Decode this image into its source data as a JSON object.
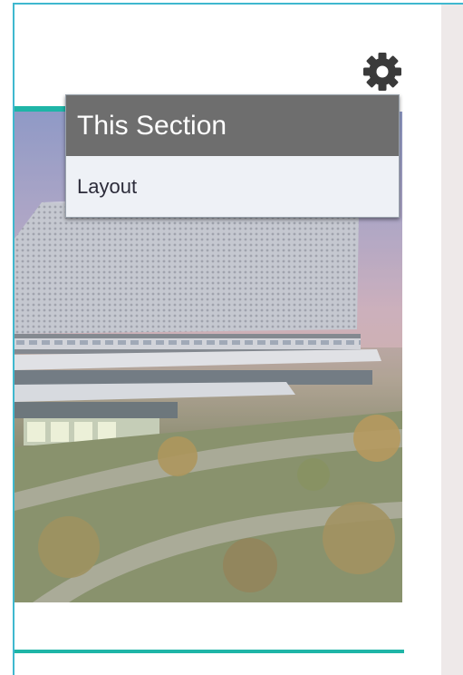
{
  "settings": {
    "icon": "gear-icon",
    "menu": {
      "header": "This Section",
      "items": [
        {
          "label": "Layout"
        }
      ]
    }
  },
  "colors": {
    "accent": "#1fb5a7",
    "frame": "#3fb8cf",
    "menu_header_bg": "#6e6e6e",
    "menu_bg": "#eef1f6",
    "side_panel": "#eee9e9"
  }
}
